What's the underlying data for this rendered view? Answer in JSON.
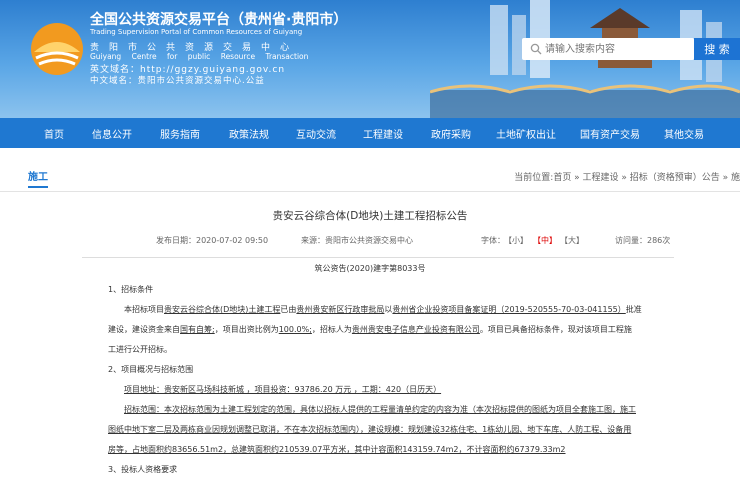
{
  "header": {
    "site_title": "全国公共资源交易平台（贵州省·贵阳市）",
    "site_subtitle_en": "Trading Supervision Portal of Common Resources of Guiyang",
    "org_name_cn": "贵阳市公共资源交易中心",
    "org_name_en": "Guiyang Centre for public Resource Transaction",
    "domain_en": "英文域名：http://ggzy.guiyang.gov.cn",
    "domain_cn": "中文域名：贵阳市公共资源交易中心.公益",
    "search_placeholder": "请输入搜索内容",
    "search_button": "搜 索"
  },
  "nav": {
    "items": [
      "首页",
      "信息公开",
      "服务指南",
      "政策法规",
      "互动交流",
      "工程建设",
      "政府采购",
      "土地矿权出让",
      "国有资产交易",
      "其他交易"
    ]
  },
  "breadcrumb": {
    "section": "施工",
    "path": "当前位置:首页 » 工程建设 » 招标（资格预审）公告 » 施"
  },
  "article": {
    "title": "贵安云谷综合体(D地块)土建工程招标公告",
    "publish_date": "发布日期：2020-07-02 09:50",
    "source": "来源：贵阳市公共资源交易中心",
    "font_label": "字体：",
    "font_small": "【小】",
    "font_medium": "【中】",
    "font_large": "【大】",
    "views": "访问量：286次",
    "doc_number": "筑公资告(2020)建字第8033号",
    "sec1_heading": "1、招标条件",
    "sec1_p1_a": "本招标项目",
    "sec1_p1_b": "贵安云谷综合体(D地块)土建工程",
    "sec1_p1_c": "已由",
    "sec1_p1_d": "贵州贵安新区行政审批局",
    "sec1_p1_e": "以",
    "sec1_p1_f": "贵州省企业投资项目备案证明（2019-520555-70-03-041155）",
    "sec1_p1_g": "批准",
    "sec1_p2_a": "建设，建设资金来自",
    "sec1_p2_b": "国有自筹;",
    "sec1_p2_c": "，项目出资比例为",
    "sec1_p2_d": "100.0%;",
    "sec1_p2_e": "，招标人为",
    "sec1_p2_f": "贵州贵安电子信息产业投资有限公司",
    "sec1_p2_g": "。项目已具备招标条件，现对该项目工程施",
    "sec1_p3": "工进行公开招标。",
    "sec2_heading": "2、项目概况与招标范围",
    "sec2_p1": "项目地址：贵安新区马场科技新城 ，项目投资：93786.20 万元 ，工期：420（日历天）",
    "sec2_p2": "招标范围：本次招标范围为土建工程划定的范围，具体以招标人提供的工程量清单约定的内容为准（本次招标提供的图纸为项目全套施工图，施工",
    "sec2_p3": "图纸中地下室二层及两栋商业因规划调整已取消，不在本次招标范围内），建设规模：规划建设32栋住宅、1栋幼儿园、地下车库、人防工程、设备用",
    "sec2_p4": "房等，占地面积约83656.51m2，总建筑面积约210539.07平方米，其中计容面积143159.74m2，不计容面积约67379.33m2",
    "sec3_heading": "3、投标人资格要求"
  }
}
